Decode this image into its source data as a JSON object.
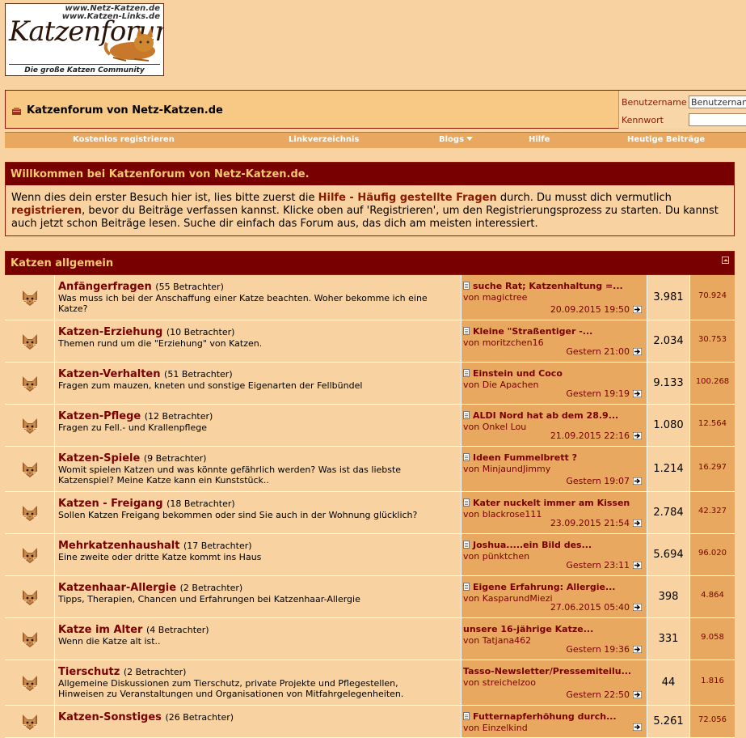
{
  "logo": {
    "url1": "www.Netz-Katzen.de",
    "url2": "www.Katzen-Links.de",
    "word": "Katzenforum",
    "tagline": "Die große Katzen Community"
  },
  "header": {
    "title": "Katzenforum von Netz-Katzen.de",
    "username_label": "Benutzername",
    "username_value": "Benutzername",
    "password_label": "Kennwort"
  },
  "nav": {
    "items": [
      {
        "label": "Kostenlos registrieren"
      },
      {
        "label": "Linkverzeichnis"
      },
      {
        "label": "Blogs"
      },
      {
        "label": "Hilfe"
      },
      {
        "label": "Heutige Beiträge"
      }
    ]
  },
  "welcome": {
    "title": "Willkommen bei Katzenforum von Netz-Katzen.de.",
    "t1": "Wenn dies dein erster Besuch hier ist, lies bitte zuerst die ",
    "link1": "Hilfe - Häufig gestellte Fragen",
    "t2": " durch. Du musst dich vermutlich ",
    "link2": "registrieren",
    "t3": ", bevor du Beiträge verfassen kannst. Klicke oben auf 'Registrieren', um den Registrierungsprozess zu starten. Du kannst auch jetzt schon Beiträge lesen. Suche dir einfach das Forum aus, das dich am meisten interessiert."
  },
  "category": {
    "title": "Katzen allgemein",
    "forums": [
      {
        "name": "Anfängerfragen",
        "viewers": "(55 Betrachter)",
        "desc": "Was muss ich bei der Anschaffung einer Katze beachten. Woher bekomme ich eine Katze?",
        "last_title": "suche Rat; Katzenhaltung =...",
        "last_by": "magictree",
        "last_date": "20.09.2015 19:50",
        "threads": "3.981",
        "posts": "70.924"
      },
      {
        "name": "Katzen-Erziehung",
        "viewers": "(10 Betrachter)",
        "desc": "Themen rund um die \"Erziehung\" von Katzen.",
        "last_title": "Kleine \"Straßentiger -...",
        "last_by": "moritzchen16",
        "last_date": "Gestern 21:00",
        "threads": "2.034",
        "posts": "30.753"
      },
      {
        "name": "Katzen-Verhalten",
        "viewers": "(51 Betrachter)",
        "desc": "Fragen zum mauzen, kneten und sonstige Eigenarten der Fellbündel",
        "last_title": "Einstein und Coco",
        "last_by": "Die Apachen",
        "last_date": "Gestern 19:19",
        "threads": "9.133",
        "posts": "100.268"
      },
      {
        "name": "Katzen-Pflege",
        "viewers": "(12 Betrachter)",
        "desc": "Fragen zu Fell.- und Krallenpflege",
        "last_title": "ALDI Nord hat ab dem 28.9...",
        "last_by": "Onkel Lou",
        "last_date": "21.09.2015 22:16",
        "threads": "1.080",
        "posts": "12.564"
      },
      {
        "name": "Katzen-Spiele",
        "viewers": "(9 Betrachter)",
        "desc": "Womit spielen Katzen und was könnte gefährlich werden? Was ist das liebste Katzenspiel? Meine Katze kann ein Kunststück..",
        "last_title": "Ideen Fummelbrett ?",
        "last_by": "MinjaundJimmy",
        "last_date": "Gestern 19:07",
        "threads": "1.214",
        "posts": "16.297"
      },
      {
        "name": "Katzen - Freigang",
        "viewers": "(18 Betrachter)",
        "desc": "Sollen Katzen Freigang bekommen oder sind Sie auch in der Wohnung glücklich?",
        "last_title": "Kater nuckelt immer am Kissen",
        "last_by": "blackrose111",
        "last_date": "23.09.2015 21:54",
        "threads": "2.784",
        "posts": "42.327"
      },
      {
        "name": "Mehrkatzenhaushalt",
        "viewers": "(17 Betrachter)",
        "desc": "Eine zweite oder dritte Katze kommt ins Haus",
        "last_title": "Joshua.....ein Bild des...",
        "last_by": "pünktchen",
        "last_date": "Gestern 23:11",
        "threads": "5.694",
        "posts": "96.020"
      },
      {
        "name": "Katzenhaar-Allergie",
        "viewers": "(2 Betrachter)",
        "desc": "Tipps, Therapien, Chancen und Erfahrungen bei Katzenhaar-Allergie",
        "last_title": "Eigene Erfahrung: Allergie...",
        "last_by": "KasparundMiezi",
        "last_date": "27.06.2015 05:40",
        "threads": "398",
        "posts": "4.864"
      },
      {
        "name": "Katze im Alter",
        "viewers": "(4 Betrachter)",
        "desc": "Wenn die Katze alt ist..",
        "last_title": "unsere 16-jährige Katze...",
        "last_by": "Tatjana462",
        "last_date": "Gestern 19:36",
        "threads": "331",
        "posts": "9.058"
      },
      {
        "name": "Tierschutz",
        "viewers": "(2 Betrachter)",
        "desc": "Allgemeine Diskussionen zum Tierschutz, private Projekte und Pflegestellen, Hinweisen zu Veranstaltungen und Organisationen von Mitfahrgelegenheiten.",
        "last_title": "Tasso-Newsletter/Pressemiteilu...",
        "last_by": "streichelzoo",
        "last_date": "Gestern 22:50",
        "threads": "44",
        "posts": "1.816"
      },
      {
        "name": "Katzen-Sonstiges",
        "viewers": "(26 Betrachter)",
        "desc": "",
        "last_title": "Futternapferhöhung durch...",
        "last_by": "Einzelkind",
        "last_date": "",
        "threads": "5.261",
        "posts": "72.056"
      }
    ]
  },
  "labels": {
    "by_prefix": "von "
  }
}
